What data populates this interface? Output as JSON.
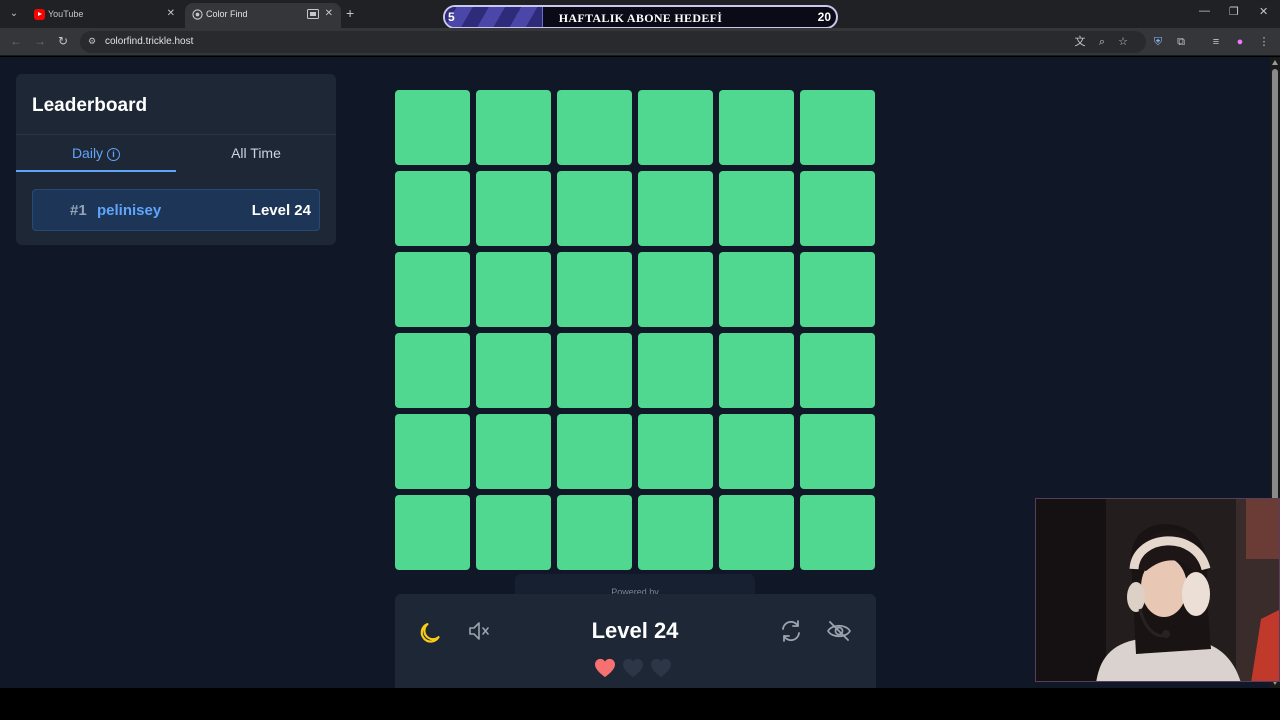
{
  "browser": {
    "tabs": [
      {
        "title": "YouTube",
        "active": false
      },
      {
        "title": "Color Find",
        "active": true
      }
    ],
    "url": "colorfind.trickle.host"
  },
  "goal_overlay": {
    "current": "5",
    "label": "HAFTALIK ABONE HEDEFİ",
    "target": "20",
    "progress_fraction": 0.25
  },
  "leaderboard": {
    "title": "Leaderboard",
    "tabs": [
      {
        "label": "Daily",
        "active": true
      },
      {
        "label": "All Time",
        "active": false
      }
    ],
    "entries": [
      {
        "rank": "#1",
        "name": "pelinisey",
        "level": "Level 24"
      }
    ]
  },
  "game": {
    "rows": 6,
    "cols": 6,
    "tile_color": "#50d890",
    "powered_by": "Powered by",
    "level_label": "Level 24",
    "lives_total": 3,
    "lives_remaining": 1,
    "controls": [
      "moon-icon",
      "mute-icon",
      "restart-icon",
      "eye-off-icon"
    ]
  },
  "colors": {
    "page_bg": "#101827",
    "panel_bg": "#1e2735",
    "accent_blue": "#60a5fa",
    "heart_red": "#f87171",
    "moon_yellow": "#facc15"
  }
}
